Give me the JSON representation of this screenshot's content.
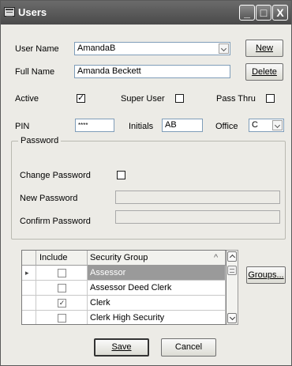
{
  "window": {
    "title": "Users",
    "minimize_glyph": "_",
    "maximize_glyph": "□",
    "close_glyph": "X"
  },
  "user_name": {
    "label": "User Name",
    "value": "AmandaB"
  },
  "full_name": {
    "label": "Full Name",
    "value": "Amanda Beckett"
  },
  "buttons": {
    "new": "New",
    "delete": "Delete",
    "groups": "Groups...",
    "save": "Save",
    "cancel": "Cancel"
  },
  "flags": {
    "active": {
      "label": "Active",
      "checked": true
    },
    "super_user": {
      "label": "Super User",
      "checked": false
    },
    "pass_thru": {
      "label": "Pass Thru",
      "checked": false
    }
  },
  "pin": {
    "label": "PIN",
    "value": "****"
  },
  "initials": {
    "label": "Initials",
    "value": "AB"
  },
  "office": {
    "label": "Office",
    "value": "C"
  },
  "password": {
    "legend": "Password",
    "change_label": "Change Password",
    "change_checked": false,
    "new_label": "New Password",
    "confirm_label": "Confirm Password"
  },
  "groups_grid": {
    "columns": [
      "Include",
      "Security Group"
    ],
    "sort_indicator": "^",
    "rows": [
      {
        "selected": true,
        "include": false,
        "group": "Assessor"
      },
      {
        "selected": false,
        "include": false,
        "group": "Assessor Deed Clerk"
      },
      {
        "selected": false,
        "include": true,
        "group": "Clerk"
      },
      {
        "selected": false,
        "include": false,
        "group": "Clerk High Security"
      }
    ]
  },
  "glyphs": {
    "check": "✓",
    "row_pointer": "▸"
  }
}
